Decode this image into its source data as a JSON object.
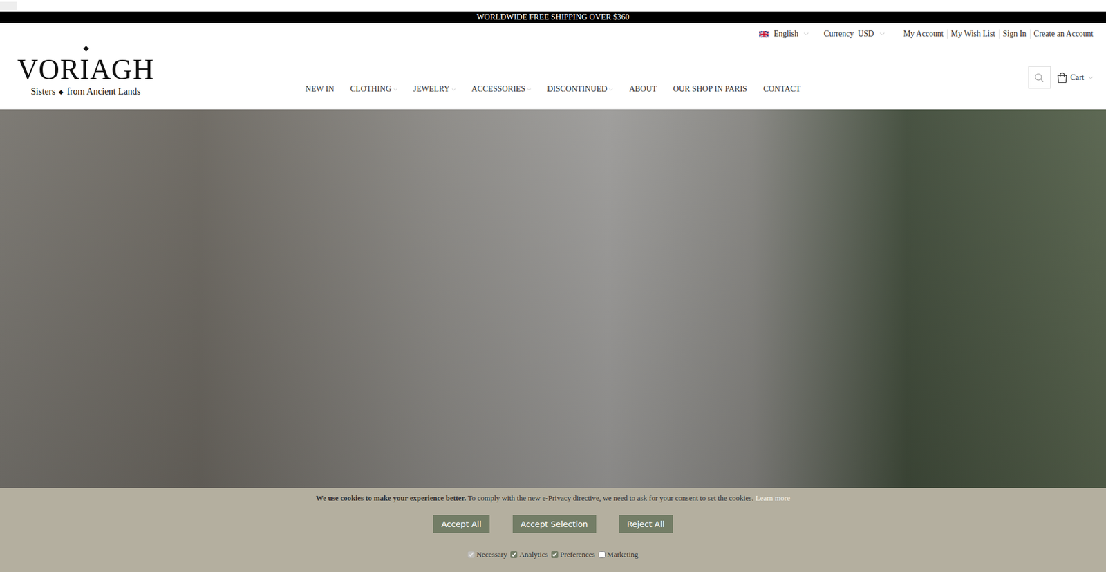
{
  "announcement": "WORLDWIDE FREE SHIPPING OVER $360",
  "top_links": {
    "language": "English",
    "currency_label": "Currency",
    "currency": "USD",
    "links": [
      "My Account",
      "My Wish List",
      "Sign In",
      "Create an Account"
    ]
  },
  "logo": {
    "title": "VORIAGH",
    "tagline_left": "Sisters",
    "tagline_mark": "◆",
    "tagline_right": "from Ancient Lands"
  },
  "nav": [
    {
      "label": "NEW IN",
      "has_dropdown": false
    },
    {
      "label": "CLOTHING",
      "has_dropdown": true
    },
    {
      "label": "JEWELRY",
      "has_dropdown": true
    },
    {
      "label": "ACCESSORIES",
      "has_dropdown": true
    },
    {
      "label": "DISCONTINUED",
      "has_dropdown": true
    },
    {
      "label": "ABOUT",
      "has_dropdown": false
    },
    {
      "label": "OUR SHOP IN PARIS",
      "has_dropdown": false
    },
    {
      "label": "CONTACT",
      "has_dropdown": false
    }
  ],
  "cart": {
    "label": "Cart"
  },
  "cookie_banner": {
    "lead": "We use cookies to make your experience better.",
    "text": "To comply with the new e-Privacy directive, we need to ask for your consent to set the cookies.",
    "link": "Learn more",
    "buttons": [
      "Accept All",
      "Accept Selection",
      "Reject All"
    ],
    "options": [
      {
        "label": "Necessary",
        "checked": true,
        "disabled": true
      },
      {
        "label": "Analytics",
        "checked": true,
        "disabled": false
      },
      {
        "label": "Preferences",
        "checked": true,
        "disabled": false
      },
      {
        "label": "Marketing",
        "checked": false,
        "disabled": false
      }
    ]
  }
}
